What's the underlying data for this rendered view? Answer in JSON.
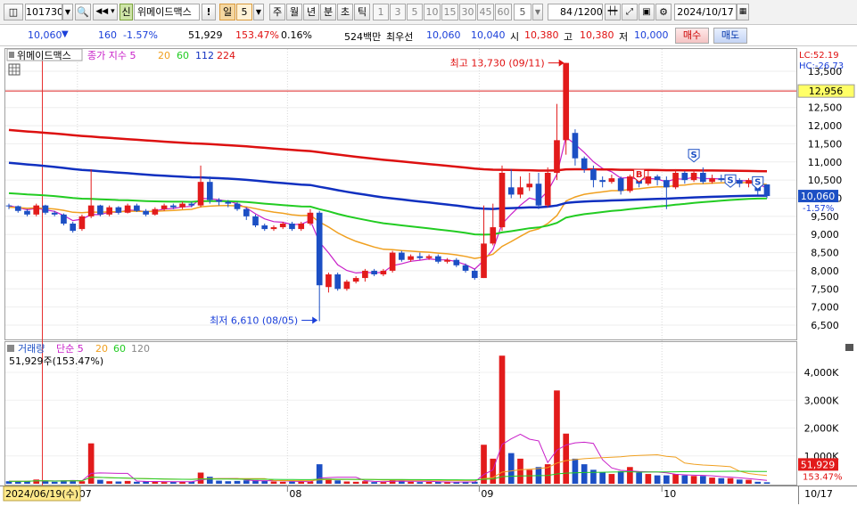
{
  "toolbar": {
    "code": "101730",
    "credit_badge": "신",
    "stock_name": "위메이드맥스",
    "excl": "!",
    "periods": [
      "주",
      "월",
      "년",
      "분",
      "초",
      "틱"
    ],
    "active_period": "일",
    "active_period_num": "5",
    "intervals": [
      "1",
      "3",
      "5",
      "10",
      "15",
      "30",
      "45",
      "60"
    ],
    "interval_value": "5",
    "count": "84",
    "count_total": "/1200",
    "date": "2024/10/17"
  },
  "quote": {
    "price": "10,060",
    "change": "160",
    "change_pct": "-1.57%",
    "volume": "51,929",
    "volume_ratio": "153.47%",
    "turnover": "0.16%",
    "amount": "524백만",
    "best_label": "최우선",
    "best_ask": "10,060",
    "best_bid": "10,040",
    "open_label": "시",
    "open": "10,380",
    "high_label": "고",
    "high": "10,380",
    "low_label": "저",
    "low": "10,000",
    "buy_label": "매수",
    "sell_label": "매도"
  },
  "legend": {
    "name": "위메이드맥스",
    "ma_label": "종가 지수 5",
    "ma": [
      "20",
      "60",
      "112",
      "224"
    ],
    "lc": "LC:52.19",
    "hc": "HC:-26.73",
    "vol_label": "거래량",
    "vol_ma_label": "단순 5",
    "vol_ma": [
      "20",
      "60",
      "120"
    ],
    "vol_value": "51,929주(153.47%)",
    "high_note": "최고 13,730 (09/11)",
    "low_note": "최저 6,610 (08/05)",
    "cursor_date": "2024/06/19(수)",
    "end_date": "10/17",
    "last_price_tag": "10,060",
    "last_pct_tag": "-1.57%",
    "ref_price_tag": "12,956",
    "last_vol_tag": "51,929",
    "last_vol_pct_tag": "153.47%"
  },
  "colors": {
    "up": "#e21b1b",
    "down": "#1c4fc4",
    "ma5": "#c81ec8",
    "ma20": "#f0a020",
    "ma60": "#22cc22",
    "ma112": "#1030c0",
    "ma224": "#dd1010"
  },
  "chart_data": {
    "type": "candlestick",
    "price_axis": {
      "min": 6500,
      "max": 13500,
      "step": 500,
      "labels": [
        "13,500",
        "13,000",
        "12,500",
        "12,000",
        "11,500",
        "11,000",
        "10,500",
        "10,000",
        "9,500",
        "9,000",
        "8,500",
        "8,000",
        "7,500",
        "7,000",
        "6,500"
      ]
    },
    "volume_axis": {
      "min": 0,
      "max": 4000000,
      "labels": [
        "4,000K",
        "3,000K",
        "2,000K",
        "1,000K"
      ]
    },
    "month_labels": [
      {
        "label": "07",
        "index": 8
      },
      {
        "label": "08",
        "index": 31
      },
      {
        "label": "09",
        "index": 52
      },
      {
        "label": "10",
        "index": 72
      }
    ],
    "reference_price": 12956,
    "candles": [
      [
        9800,
        9780,
        9850,
        9700,
        90
      ],
      [
        9780,
        9650,
        9800,
        9600,
        80
      ],
      [
        9650,
        9550,
        9700,
        9500,
        85
      ],
      [
        9550,
        9800,
        9850,
        9500,
        150
      ],
      [
        9800,
        9600,
        9820,
        9550,
        110
      ],
      [
        9600,
        9550,
        9650,
        9500,
        70
      ],
      [
        9550,
        9300,
        9580,
        9250,
        120
      ],
      [
        9300,
        9100,
        9350,
        9050,
        130
      ],
      [
        9150,
        9500,
        9550,
        9100,
        90
      ],
      [
        9500,
        9800,
        10800,
        9450,
        1450
      ],
      [
        9800,
        9550,
        9820,
        9500,
        140
      ],
      [
        9550,
        9750,
        9800,
        9500,
        90
      ],
      [
        9750,
        9600,
        9780,
        9550,
        80
      ],
      [
        9600,
        9800,
        9850,
        9580,
        100
      ],
      [
        9800,
        9650,
        9850,
        9620,
        70
      ],
      [
        9650,
        9550,
        9700,
        9500,
        80
      ],
      [
        9550,
        9700,
        9750,
        9520,
        70
      ],
      [
        9700,
        9800,
        9850,
        9650,
        60
      ],
      [
        9800,
        9750,
        9850,
        9700,
        65
      ],
      [
        9750,
        9850,
        9900,
        9700,
        80
      ],
      [
        9850,
        9800,
        9900,
        9750,
        75
      ],
      [
        9800,
        10450,
        10900,
        9750,
        400
      ],
      [
        10450,
        9950,
        10600,
        9850,
        250
      ],
      [
        9950,
        9900,
        10000,
        9800,
        110
      ],
      [
        9900,
        9850,
        9950,
        9750,
        90
      ],
      [
        9850,
        9700,
        9900,
        9650,
        100
      ],
      [
        9700,
        9500,
        9750,
        9400,
        120
      ],
      [
        9500,
        9250,
        9550,
        9200,
        130
      ],
      [
        9250,
        9150,
        9300,
        9100,
        110
      ],
      [
        9150,
        9200,
        9250,
        9100,
        80
      ],
      [
        9200,
        9300,
        9350,
        9150,
        70
      ],
      [
        9300,
        9150,
        9350,
        9100,
        75
      ],
      [
        9150,
        9300,
        9350,
        9100,
        70
      ],
      [
        9300,
        9600,
        9700,
        9250,
        80
      ],
      [
        9600,
        7600,
        9650,
        6610,
        700
      ],
      [
        7550,
        7900,
        7950,
        7400,
        180
      ],
      [
        7900,
        7500,
        7950,
        7450,
        120
      ],
      [
        7500,
        7700,
        7750,
        7450,
        80
      ],
      [
        7700,
        7800,
        7850,
        7650,
        70
      ],
      [
        7800,
        8000,
        8050,
        7700,
        90
      ],
      [
        8000,
        7900,
        8050,
        7850,
        60
      ],
      [
        7900,
        8000,
        8050,
        7850,
        60
      ],
      [
        8000,
        8500,
        8550,
        7950,
        150
      ],
      [
        8500,
        8300,
        8550,
        8250,
        100
      ],
      [
        8300,
        8400,
        8450,
        8250,
        70
      ],
      [
        8400,
        8350,
        8500,
        8300,
        60
      ],
      [
        8350,
        8400,
        8450,
        8300,
        65
      ],
      [
        8400,
        8250,
        8450,
        8200,
        70
      ],
      [
        8250,
        8300,
        8350,
        8200,
        55
      ],
      [
        8300,
        8150,
        8350,
        8100,
        60
      ],
      [
        8150,
        8000,
        8200,
        7950,
        65
      ],
      [
        8000,
        7800,
        8050,
        7750,
        70
      ],
      [
        7800,
        8750,
        9800,
        7800,
        1400
      ],
      [
        8750,
        9200,
        9850,
        8700,
        900
      ],
      [
        9200,
        10700,
        10900,
        9100,
        4600
      ],
      [
        10300,
        10100,
        10800,
        10000,
        1100
      ],
      [
        10100,
        10300,
        10600,
        10000,
        900
      ],
      [
        10300,
        10400,
        10700,
        10200,
        500
      ],
      [
        10400,
        9800,
        10700,
        9700,
        600
      ],
      [
        9800,
        10700,
        10850,
        9750,
        700
      ],
      [
        10700,
        11600,
        12600,
        10500,
        3350
      ],
      [
        11600,
        13730,
        13730,
        11200,
        1800
      ],
      [
        11800,
        11100,
        11900,
        10900,
        900
      ],
      [
        11100,
        10800,
        11150,
        10700,
        700
      ],
      [
        10800,
        10500,
        10900,
        10300,
        500
      ],
      [
        10500,
        10450,
        10600,
        10300,
        400
      ],
      [
        10450,
        10550,
        10650,
        10400,
        350
      ],
      [
        10550,
        10200,
        10600,
        10100,
        450
      ],
      [
        10200,
        10600,
        10650,
        10150,
        600
      ],
      [
        10600,
        10400,
        10700,
        10300,
        400
      ],
      [
        10400,
        10600,
        10750,
        10350,
        350
      ],
      [
        10600,
        10500,
        10650,
        10350,
        300
      ],
      [
        10500,
        10300,
        10600,
        9700,
        300
      ],
      [
        10300,
        10700,
        10800,
        10250,
        350
      ],
      [
        10700,
        10500,
        10750,
        10400,
        300
      ],
      [
        10500,
        10700,
        10800,
        10450,
        280
      ],
      [
        10700,
        10450,
        10850,
        10400,
        280
      ],
      [
        10450,
        10550,
        10650,
        10400,
        220
      ],
      [
        10550,
        10500,
        10650,
        10450,
        200
      ],
      [
        10500,
        10500,
        10600,
        10400,
        200
      ],
      [
        10500,
        10400,
        10550,
        10300,
        150
      ],
      [
        10400,
        10500,
        10550,
        10300,
        140
      ],
      [
        10400,
        10200,
        10450,
        10100,
        70
      ],
      [
        10380,
        10060,
        10380,
        10000,
        52
      ]
    ],
    "markers": [
      {
        "type": "S",
        "index": 75,
        "price": 11000
      },
      {
        "type": "B",
        "index": 69,
        "price": 10450
      },
      {
        "type": "S",
        "index": 79,
        "price": 10300
      },
      {
        "type": "S",
        "index": 82,
        "price": 10250
      }
    ]
  }
}
